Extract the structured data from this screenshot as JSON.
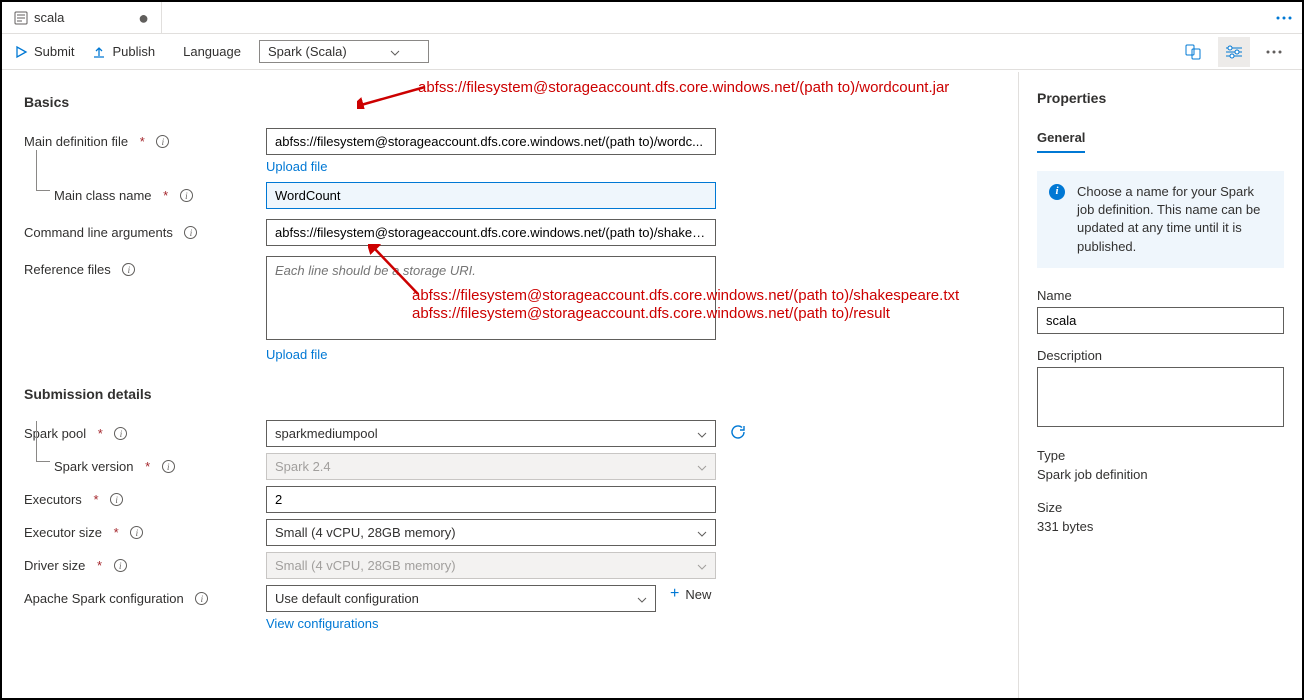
{
  "tab": {
    "title": "scala",
    "dirty": true
  },
  "toolbar": {
    "submit": "Submit",
    "publish": "Publish",
    "languageLabel": "Language",
    "languageValue": "Spark (Scala)"
  },
  "form": {
    "basicsHeading": "Basics",
    "mainDefLabel": "Main definition file",
    "mainDefValue": "abfss://filesystem@storageaccount.dfs.core.windows.net/(path to)/wordc...",
    "uploadFile": "Upload file",
    "mainClassLabel": "Main class name",
    "mainClassValue": "WordCount",
    "cmdArgsLabel": "Command line arguments",
    "cmdArgsValue": "abfss://filesystem@storageaccount.dfs.core.windows.net/(path to)/shakes...",
    "refFilesLabel": "Reference files",
    "refFilesPlaceholder": "Each line should be a storage URI.",
    "submissionHeading": "Submission details",
    "sparkPoolLabel": "Spark pool",
    "sparkPoolValue": "sparkmediumpool",
    "sparkVersionLabel": "Spark version",
    "sparkVersionValue": "Spark 2.4",
    "executorsLabel": "Executors",
    "executorsValue": "2",
    "executorSizeLabel": "Executor size",
    "executorSizeValue": "Small (4 vCPU, 28GB memory)",
    "driverSizeLabel": "Driver size",
    "driverSizeValue": "Small (4 vCPU, 28GB memory)",
    "apacheConfigLabel": "Apache Spark configuration",
    "apacheConfigValue": "Use default configuration",
    "newLabel": "New",
    "viewConfigs": "View configurations"
  },
  "annotations": {
    "a1": "abfss://filesystem@storageaccount.dfs.core.windows.net/(path to)/wordcount.jar",
    "a2": "abfss://filesystem@storageaccount.dfs.core.windows.net/(path to)/shakespeare.txt",
    "a3": "abfss://filesystem@storageaccount.dfs.core.windows.net/(path to)/result"
  },
  "props": {
    "heading": "Properties",
    "tab": "General",
    "infoText": "Choose a name for your Spark job definition. This name can be updated at any time until it is published.",
    "nameLabel": "Name",
    "nameValue": "scala",
    "descLabel": "Description",
    "typeLabel": "Type",
    "typeValue": "Spark job definition",
    "sizeLabel": "Size",
    "sizeValue": "331 bytes"
  }
}
